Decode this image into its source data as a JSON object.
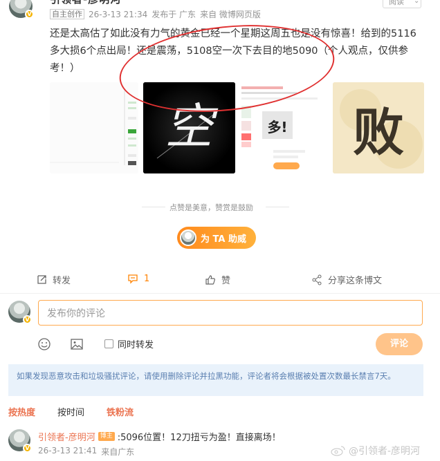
{
  "post": {
    "author_name_cut": "引领者-彦明河",
    "original_tag": "自主创作",
    "timestamp": "26-3-13 21:34",
    "published_in": "发布于 广东",
    "source": "来自 微博网页版",
    "follow_label": "阅读",
    "text": "还是太高估了如此没有力气的黄金已经一个星期这周五也是没有惊喜！给到的5116多大损6个点出局！还是震荡，5108空一次下去目的地5090（个人观点，仅供参考！）",
    "images": [
      {
        "alt": "K线截图"
      },
      {
        "alt": "空",
        "glyph": "空"
      },
      {
        "alt": "交易截图",
        "caption": "多!"
      },
      {
        "alt": "败",
        "glyph": "败"
      }
    ],
    "encourage_text": "点赞是美意，赞赏是鼓励",
    "support_label": "为 TA 助威"
  },
  "actions": {
    "repost": "转发",
    "comment": "1",
    "like": "赞",
    "share": "分享这条博文"
  },
  "composer": {
    "placeholder": "发布你的评论",
    "repost_label": "同时转发",
    "submit_label": "评论"
  },
  "notice": "如果发现恶意攻击和垃圾骚扰评论，请使用删除评论并拉黑功能，评论者将会根据被处置次数最长禁言7天。",
  "sort_tabs": [
    "按热度",
    "按时间",
    "铁粉流"
  ],
  "comment": {
    "name": "引领者-彦明河",
    "badge": "博主",
    "text": ":5096位置！12刀扭亏为盈！直接离场！",
    "time": "26-3-13 21:41",
    "location": "来自广东"
  },
  "watermark": "@引领者-彦明河",
  "colors": {
    "accent": "#ff8200",
    "name_orange": "#eb7350",
    "annotation_red": "#e03131",
    "notice_bg": "#e9f2fb"
  }
}
